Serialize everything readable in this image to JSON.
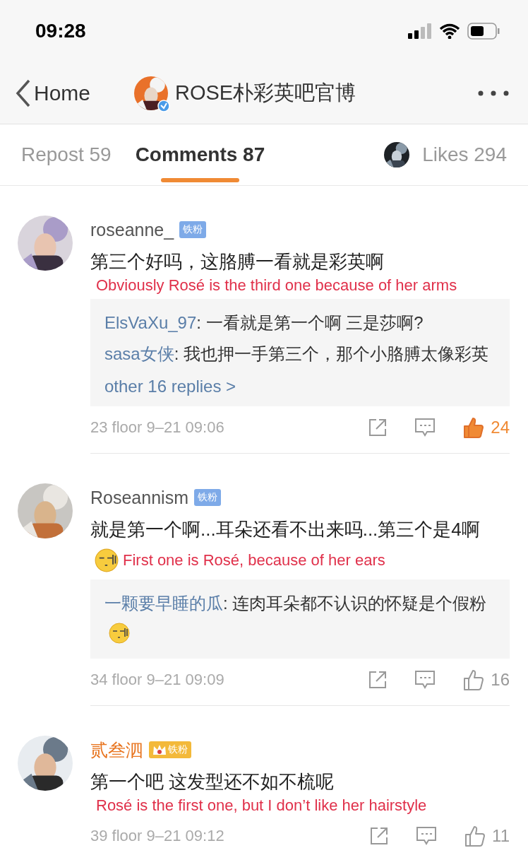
{
  "status_bar": {
    "time": "09:28"
  },
  "nav": {
    "back_label": "Home",
    "title": "ROSE朴彩英吧官博",
    "verified": true
  },
  "tabs": [
    {
      "label": "Repost 59",
      "selected": false
    },
    {
      "label": "Comments 87",
      "selected": true
    },
    {
      "label": "Likes 294",
      "selected": false,
      "avatar": true
    }
  ],
  "comments": [
    {
      "name": "roseanne_",
      "badge": "铁粉",
      "text": "第三个好吗，这胳膊一看就是彩英啊",
      "annotation": {
        "text": "Obviously Rosé is the third one because of her arms",
        "kind": "below"
      },
      "replies": [
        {
          "user": "ElsVaXu_97",
          "text": ": 一看就是第一个啊 三是莎啊?"
        },
        {
          "user": "sasa女侠",
          "text": ": 我也押一手第三个，那个小胳膊太像彩英"
        }
      ],
      "more_replies": "other 16 replies >",
      "floor": "23 floor",
      "time": "9–21 09:06",
      "likes": "24",
      "liked": true
    },
    {
      "name": "Roseannism",
      "badge": "铁粉",
      "text": "就是第一个啊...耳朵还看不出来吗...第三个是4啊",
      "emoji": true,
      "annotation": {
        "text": "First one is Rosé, because of her ears",
        "kind": "inline"
      },
      "replies": [
        {
          "user": "一颗要早睡的瓜",
          "text": ": 连肉耳朵都不认识的怀疑是个假粉",
          "emoji": true
        }
      ],
      "floor": "34 floor",
      "time": "9–21 09:09",
      "likes": "16",
      "liked": false
    },
    {
      "name": "贰叁泗",
      "vip": true,
      "badge": "铁粉",
      "text": "第一个吧 这发型还不如不梳呢",
      "annotation": {
        "text": "Rosé is the first one, but I don’t like her hairstyle",
        "kind": "below"
      },
      "floor": "39 floor",
      "time": "9–21 09:12",
      "likes": "11",
      "liked": false
    }
  ]
}
